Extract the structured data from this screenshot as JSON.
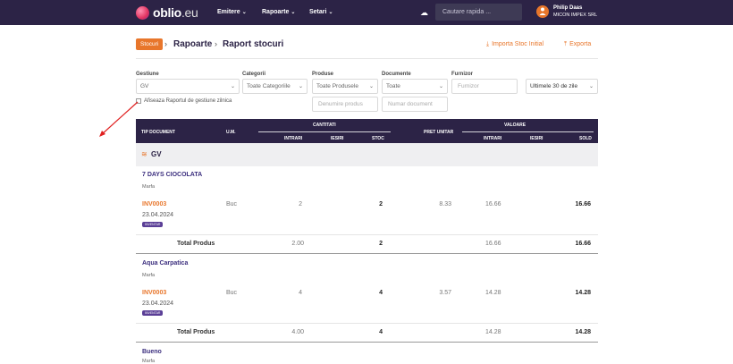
{
  "app": {
    "logo_text": "oblio",
    "logo_suffix": ".eu",
    "colors": {
      "navbar": "#2c2346",
      "accent": "#e8762b",
      "link": "#3b2e7e"
    }
  },
  "nav": {
    "items": [
      {
        "label": "Emitere"
      },
      {
        "label": "Rapoarte"
      },
      {
        "label": "Setari"
      }
    ],
    "search_placeholder": "Cautare rapida ...",
    "user": {
      "name": "Philip Daas",
      "company": "MICON IMPEX SRL",
      "initial": ""
    }
  },
  "breadcrumb": {
    "badge": "Stocuri",
    "items": [
      "Rapoarte",
      "Raport stocuri"
    ]
  },
  "actions": {
    "import_label": "Importa Stoc Initial",
    "export_label": "Exporta"
  },
  "filters": {
    "gestiune": {
      "label": "Gestiune",
      "value": "GV"
    },
    "categorii": {
      "label": "Categorii",
      "value": "Toate Categoriile"
    },
    "produse": {
      "label": "Produse",
      "value": "Toate Produsele"
    },
    "documente": {
      "label": "Documente",
      "value": "Toate"
    },
    "furnizor": {
      "label": "Furnizor",
      "placeholder": "Furnizor"
    },
    "period": {
      "value": "Ultimele 30 de zile"
    },
    "denumire_placeholder": "Denumire produs",
    "numar_placeholder": "Numar document",
    "checkbox_label": "Afiseaza Raportul de gestiune zilnica"
  },
  "table": {
    "headers": {
      "tip_document": "TIP DOCUMENT",
      "um": "U.M.",
      "cantitati": "CANTITATI",
      "intrari": "INTRARI",
      "iesiri": "IESIRI",
      "stoc": "STOC",
      "pret_unitar": "PRET UNITAR",
      "valoare": "VALOARE",
      "v_intrari": "INTRARI",
      "v_iesiri": "IESIRI",
      "sold": "SOLD"
    },
    "group": "GV",
    "total_label": "Total Produs",
    "products": [
      {
        "name": "7 DAYS CIOCOLATA",
        "type": "Marfa",
        "doc": "INV0003",
        "date": "23.04.2024",
        "badge": "INVENTAR",
        "um": "Buc",
        "intrari": "2",
        "stoc": "2",
        "pret": "8.33",
        "v_intrari": "16.66",
        "sold": "16.66",
        "total": {
          "intrari": "2.00",
          "stoc": "2",
          "v_intrari": "16.66",
          "sold": "16.66"
        }
      },
      {
        "name": "Aqua Carpatica",
        "type": "Marfa",
        "doc": "INV0003",
        "date": "23.04.2024",
        "badge": "INVENTAR",
        "um": "Buc",
        "intrari": "4",
        "stoc": "4",
        "pret": "3.57",
        "v_intrari": "14.28",
        "sold": "14.28",
        "total": {
          "intrari": "4.00",
          "stoc": "4",
          "v_intrari": "14.28",
          "sold": "14.28"
        }
      },
      {
        "name": "Bueno",
        "type": "Marfa"
      }
    ]
  }
}
